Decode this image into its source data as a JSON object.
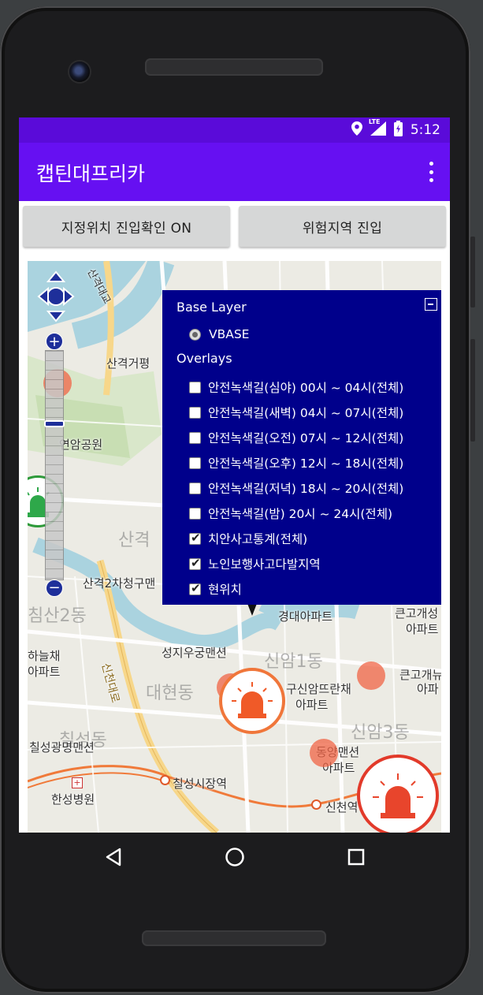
{
  "status_bar": {
    "network": "LTE",
    "time": "5:12"
  },
  "app_bar": {
    "title": "캡틴대프리카",
    "overflow_icon": "more-vert-icon"
  },
  "buttons": {
    "toggle_label": "지정위치 진입확인 ON",
    "danger_label": "위험지역 진입"
  },
  "layer_switcher": {
    "base_title": "Base Layer",
    "base_option": "VBASE",
    "overlays_title": "Overlays",
    "overlays": [
      {
        "label": "안전녹색길(심야) 00시 ~ 04시(전체)",
        "checked": false
      },
      {
        "label": "안전녹색길(새벽) 04시 ~ 07시(전체)",
        "checked": false
      },
      {
        "label": "안전녹색길(오전) 07시 ~ 12시(전체)",
        "checked": false
      },
      {
        "label": "안전녹색길(오후) 12시 ~ 18시(전체)",
        "checked": false
      },
      {
        "label": "안전녹색길(저녁) 18시 ~ 20시(전체)",
        "checked": false
      },
      {
        "label": "안전녹색길(밤) 20시 ~ 24시(전체)",
        "checked": false
      },
      {
        "label": "치안사고통계(전체)",
        "checked": true
      },
      {
        "label": "노인보행사고다발지역",
        "checked": true
      },
      {
        "label": "현위치",
        "checked": true
      }
    ]
  },
  "map": {
    "labels": {
      "a": "산격거평",
      "b": "연암공원",
      "c": "산격2차청구맨",
      "d": "경대아파트",
      "e": "큰고개성",
      "f": "아파트",
      "g": "성지우궁맨션",
      "h": "구신암뜨란채",
      "i": "아파트",
      "j": "큰고개뉴",
      "k": "아파",
      "l": "하늘채",
      "m": "아파트",
      "n": "칠성광명맨션",
      "o": "동양맨션",
      "p": "아파트",
      "q": "칠성시장역",
      "r": "한성병원",
      "s": "신천역",
      "t": "신천대로",
      "u": "산격대교"
    },
    "district_labels": {
      "a": "산격",
      "b": "침산2동",
      "c": "대현동",
      "d": "신암1동",
      "e": "신암3동",
      "f": "칠성동"
    }
  }
}
